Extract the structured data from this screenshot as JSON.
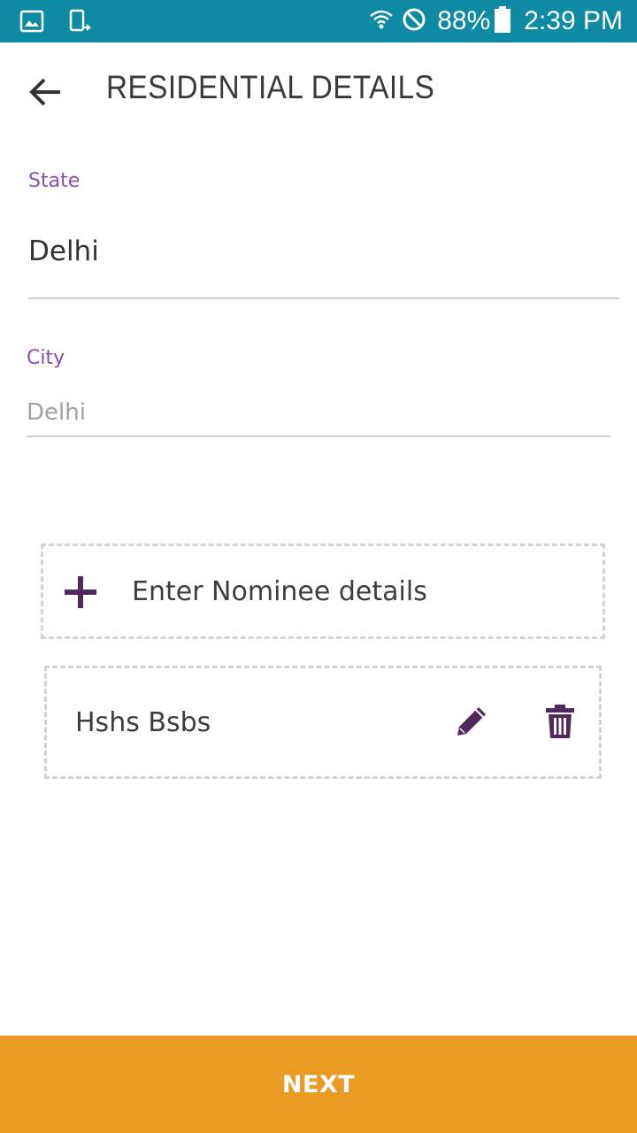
{
  "status_bar": {
    "battery": "88%",
    "time": "2:39 PM",
    "icons": [
      "gallery-icon",
      "screen-rotate-icon",
      "wifi-icon",
      "do-not-disturb-icon",
      "battery-icon"
    ]
  },
  "header": {
    "title": "RESIDENTIAL DETAILS",
    "back_icon": "arrow-left-icon"
  },
  "form": {
    "state": {
      "label": "State",
      "value": "Delhi"
    },
    "city": {
      "label": "City",
      "placeholder": "Delhi",
      "value": ""
    }
  },
  "nominee": {
    "add_label": "Enter Nominee details",
    "add_icon": "plus-icon",
    "entries": [
      {
        "name": "Hshs Bsbs",
        "edit_icon": "pencil-icon",
        "delete_icon": "trash-icon"
      }
    ]
  },
  "footer": {
    "next_label": "NEXT"
  },
  "colors": {
    "status_bar": "#0e8aa3",
    "label_accent": "#8a4fb0",
    "icon_purple": "#4f2a5a",
    "next_button": "#e99b23"
  }
}
